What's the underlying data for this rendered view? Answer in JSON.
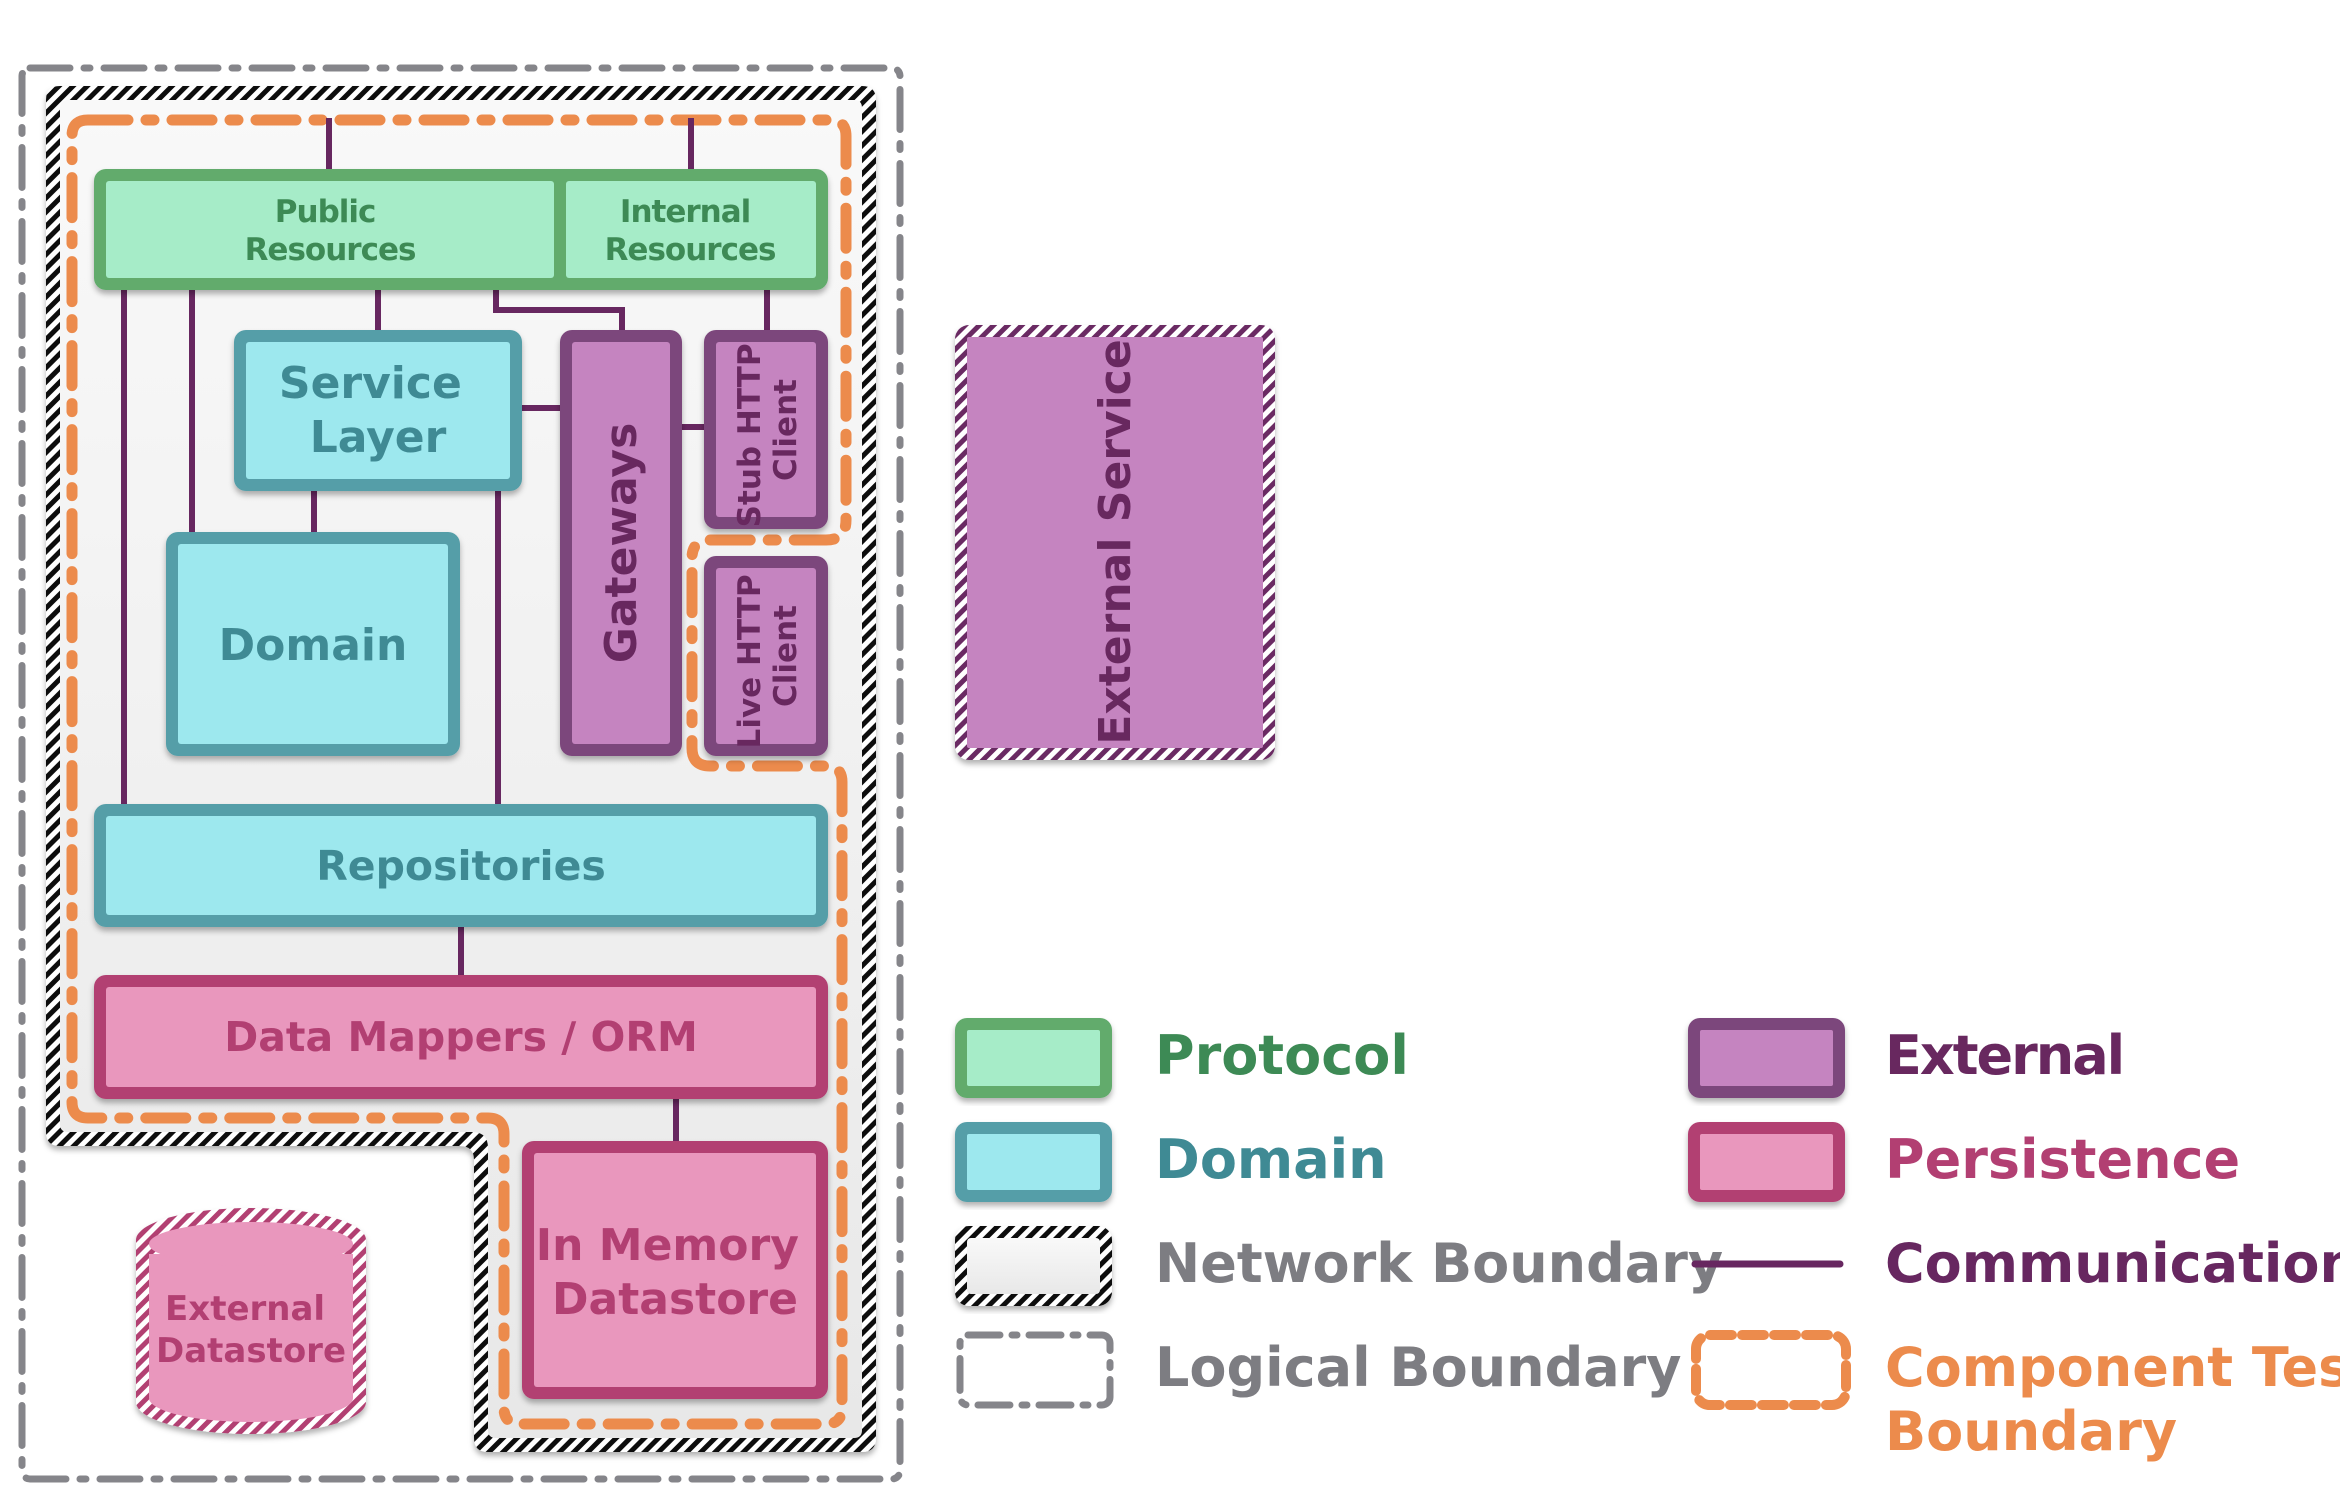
{
  "diagram": {
    "components": {
      "public_resources": "Public Resources",
      "internal_resources": "Internal Resources",
      "service_layer": "Service Layer",
      "domain": "Domain",
      "gateways": "Gateways",
      "stub_http_client": "Stub HTTP Client",
      "live_http_client": "Live HTTP Client",
      "repositories": "Repositories",
      "data_mappers": "Data Mappers / ORM",
      "in_memory_datastore": "In Memory Datastore",
      "external_datastore": "External Datastore",
      "external_service": "External Service"
    },
    "lines": {
      "public_resources": [
        "Public",
        "Resources"
      ],
      "internal_resources": [
        "Internal",
        "Resources"
      ],
      "service_layer": [
        "Service",
        "Layer"
      ],
      "stub_http_client": [
        "Stub HTTP",
        "Client"
      ],
      "live_http_client": [
        "Live HTTP",
        "Client"
      ],
      "in_memory_datastore": [
        "In Memory",
        "Datastore"
      ],
      "external_datastore": [
        "External",
        "Datastore"
      ]
    }
  },
  "legend": {
    "protocol": "Protocol",
    "domain": "Domain",
    "network_boundary": "Network Boundary",
    "logical_boundary": "Logical Boundary",
    "external": "External",
    "persistence": "Persistence",
    "communication": "Communication",
    "component_test_boundary_line1": "Component Test",
    "component_test_boundary_line2": "Boundary"
  },
  "colors": {
    "protocol_fill": "#a6ecc8",
    "protocol_stroke": "#62ab6c",
    "protocol_text": "#3d8a55",
    "domain_fill": "#9de8ee",
    "domain_stroke": "#559ea8",
    "domain_text": "#3f8a94",
    "external_fill": "#c584c0",
    "external_stroke": "#7c477c",
    "external_text": "#68285f",
    "persistence_fill": "#e997bd",
    "persistence_stroke": "#b23f72",
    "persistence_text": "#b23f72",
    "communication": "#672760",
    "component_test": "#ec8b4c",
    "logical_boundary": "#85858a",
    "network_text": "#7d7d82"
  }
}
